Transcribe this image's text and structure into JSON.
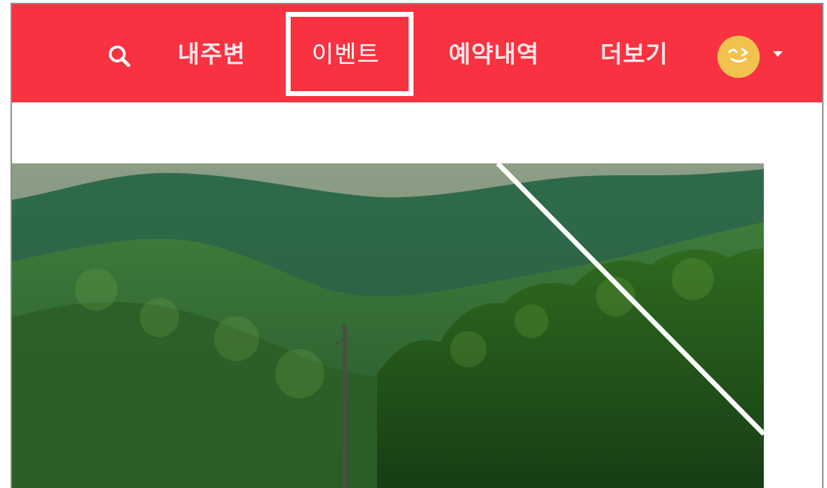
{
  "header": {
    "nav_items": [
      {
        "label": "내주변"
      },
      {
        "label": "이벤트"
      },
      {
        "label": "예약내역"
      },
      {
        "label": "더보기"
      }
    ],
    "accent_color": "#f83241",
    "highlighted_item": "이벤트"
  },
  "icons": {
    "search": "search-icon",
    "avatar": "smiley-avatar-icon",
    "dropdown": "caret-down-icon"
  },
  "hero": {
    "description": "mountain-landscape-photo"
  }
}
